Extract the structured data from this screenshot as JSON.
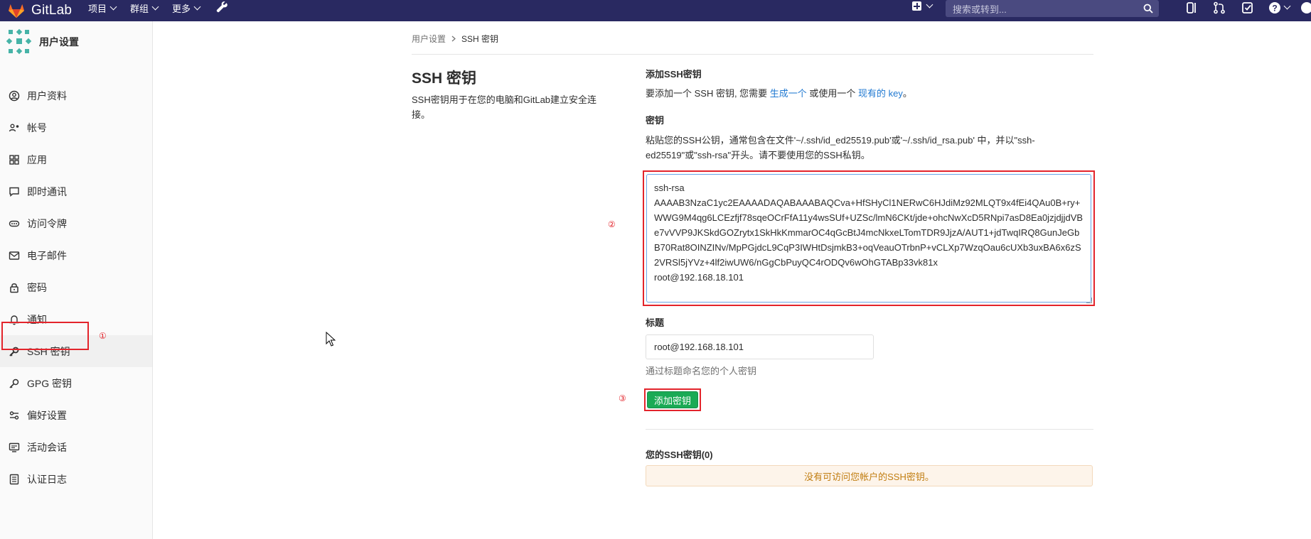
{
  "navbar": {
    "brand": "GitLab",
    "menu": [
      {
        "label": "项目"
      },
      {
        "label": "群组"
      },
      {
        "label": "更多"
      }
    ],
    "search_placeholder": "搜索或转到..."
  },
  "sidebar": {
    "title": "用户设置",
    "items": [
      {
        "label": "用户资料",
        "icon": "user-circle-icon"
      },
      {
        "label": "帐号",
        "icon": "account-gear-icon"
      },
      {
        "label": "应用",
        "icon": "applications-grid-icon"
      },
      {
        "label": "即时通讯",
        "icon": "chat-bubble-icon"
      },
      {
        "label": "访问令牌",
        "icon": "token-icon"
      },
      {
        "label": "电子邮件",
        "icon": "mail-icon"
      },
      {
        "label": "密码",
        "icon": "lock-icon"
      },
      {
        "label": "通知",
        "icon": "bell-icon"
      },
      {
        "label": "SSH 密钥",
        "icon": "key-icon",
        "active": true
      },
      {
        "label": "GPG 密钥",
        "icon": "key-icon"
      },
      {
        "label": "偏好设置",
        "icon": "preferences-icon"
      },
      {
        "label": "活动会话",
        "icon": "monitor-icon"
      },
      {
        "label": "认证日志",
        "icon": "log-list-icon"
      }
    ],
    "marker": "①"
  },
  "breadcrumb": {
    "parent": "用户设置",
    "current": "SSH 密钥"
  },
  "page": {
    "title": "SSH 密钥",
    "description": "SSH密钥用于在您的电脑和GitLab建立安全连接。"
  },
  "form": {
    "add_heading": "添加SSH密钥",
    "intro_before": "要添加一个 SSH 密钥, 您需要 ",
    "intro_link1": "生成一个",
    "intro_middle": " 或使用一个 ",
    "intro_link2": "现有的 key",
    "intro_after": "。",
    "key_label": "密钥",
    "key_help": "粘贴您的SSH公钥，通常包含在文件'~/.ssh/id_ed25519.pub'或'~/.ssh/id_rsa.pub' 中，并以\"ssh-ed25519\"或\"ssh-rsa\"开头。请不要使用您的SSH私钥。",
    "key_value": "ssh-rsa\nAAAAB3NzaC1yc2EAAAADAQABAAABAQCva+HfSHyCl1NERwC6HJdiMz92MLQT9x4fEi4QAu0B+ry+WWG9M4qg6LCEzfjf78sqeOCrFfA11y4wsSUf+UZSc/lmN6CKt/jde+ohcNwXcD5RNpi7asD8Ea0jzjdjjdVBe7vVVP9JKSkdGOZrytx1SkHkKmmarOC4qGcBtJ4mcNkxeLTomTDR9JjzA/AUT1+jdTwqIRQ8GunJeGbB70Rat8OINZINv/MpPGjdcL9CqP3IWHtDsjmkB3+oqVeauOTrbnP+vCLXp7WzqOau6cUXb3uxBA6x6zS2VRSl5jYVz+4lf2iwUW6/nGgCbPuyQC4rODQv6wOhGTABp33vk81x\nroot@192.168.18.101",
    "title_label": "标题",
    "title_value": "root@192.168.18.101",
    "title_hint": "通过标题命名您的个人密钥",
    "submit_label": "添加密钥",
    "marker_textarea": "②",
    "marker_button": "③"
  },
  "your_keys": {
    "heading": "您的SSH密钥(0)",
    "empty_text": "没有可访问您帐户的SSH密钥。"
  },
  "colors": {
    "navbar": "#292961",
    "link": "#1f78d1",
    "success_button": "#1aaa55",
    "annotation": "#e3242b",
    "warning_bg": "#fdf4ea",
    "warning_text": "#c17d10"
  }
}
